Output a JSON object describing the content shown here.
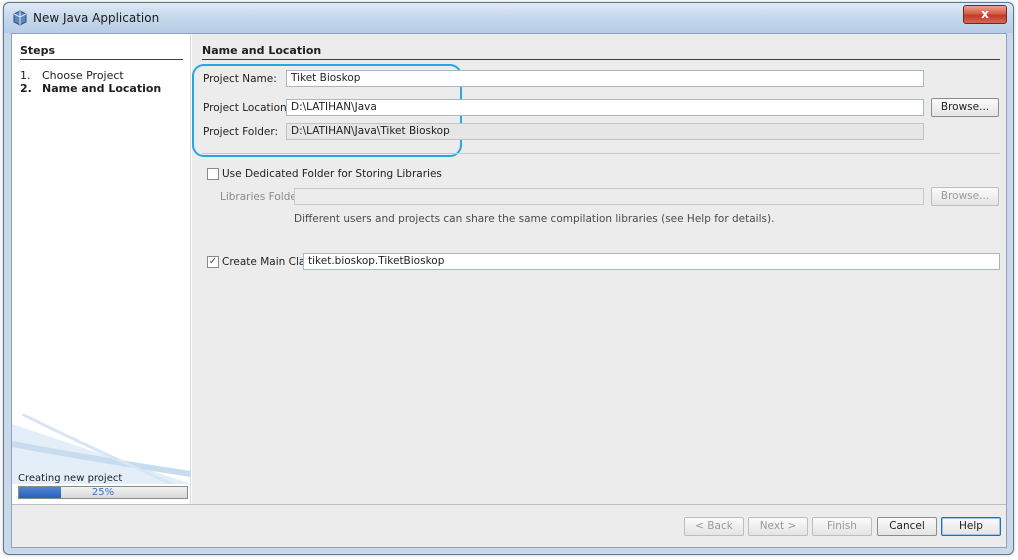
{
  "window": {
    "title": "New Java Application",
    "close_label": "x"
  },
  "steps": {
    "title": "Steps",
    "items": [
      {
        "num": "1.",
        "label": "Choose Project"
      },
      {
        "num": "2.",
        "label": "Name and Location"
      }
    ],
    "current_step": 2,
    "status_label": "Creating new project",
    "progress": {
      "percent": 25,
      "text": "25%"
    }
  },
  "main": {
    "section_title": "Name and Location",
    "project_name": {
      "label": "Project Name:",
      "value": "Tiket Bioskop"
    },
    "project_location": {
      "label": "Project Location:",
      "value": "D:\\LATIHAN\\Java",
      "browse_label": "Browse..."
    },
    "project_folder": {
      "label": "Project Folder:",
      "value": "D:\\LATIHAN\\Java\\Tiket Bioskop"
    },
    "dedicated_folder": {
      "label": "Use Dedicated Folder for Storing Libraries",
      "checked": false
    },
    "libraries_folder": {
      "label": "Libraries Folder:",
      "value": "",
      "browse_label": "Browse..."
    },
    "libraries_hint": "Different users and projects can share the same compilation libraries (see Help for details).",
    "create_main_class": {
      "label": "Create Main Class",
      "checked": true,
      "value": "tiket.bioskop.TiketBioskop"
    }
  },
  "footer": {
    "back_label": "< Back",
    "next_label": "Next >",
    "finish_label": "Finish",
    "cancel_label": "Cancel",
    "help_label": "Help"
  },
  "colors": {
    "highlight": "#28a6e0",
    "progress": "#2a5fb8",
    "close_button": "#c0392b"
  },
  "icons": {
    "app": "java-cup-icon",
    "close": "close-icon",
    "check": "checkmark-icon"
  }
}
